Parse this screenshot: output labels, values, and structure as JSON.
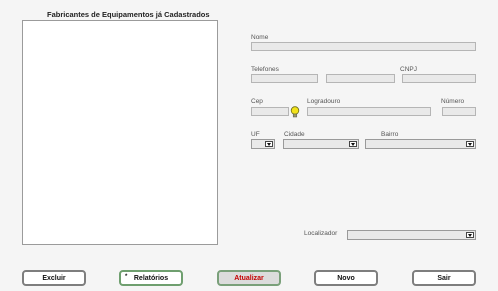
{
  "list": {
    "title": "Fabricantes de Equipamentos já Cadastrados"
  },
  "form": {
    "nome_label": "Nome",
    "telefones_label": "Telefones",
    "cnpj_label": "CNPJ",
    "cep_label": "Cep",
    "logradouro_label": "Logradouro",
    "numero_label": "Número",
    "uf_label": "UF",
    "cidade_label": "Cidade",
    "bairro_label": "Bairro",
    "localizador_label": "Localizador"
  },
  "buttons": {
    "excluir": "Excluir",
    "relatorios": "Relatórios",
    "relatorios_marker": "*",
    "atualizar": "Atualizar",
    "novo": "Novo",
    "sair": "Sair"
  },
  "colors": {
    "atualizar_text": "#c40000",
    "button_border": "#7e7e7e",
    "bulb": "#f2e21a"
  },
  "icons": {
    "cep_lookup": "lightbulb-icon",
    "dropdown": "chevron-down-icon"
  }
}
